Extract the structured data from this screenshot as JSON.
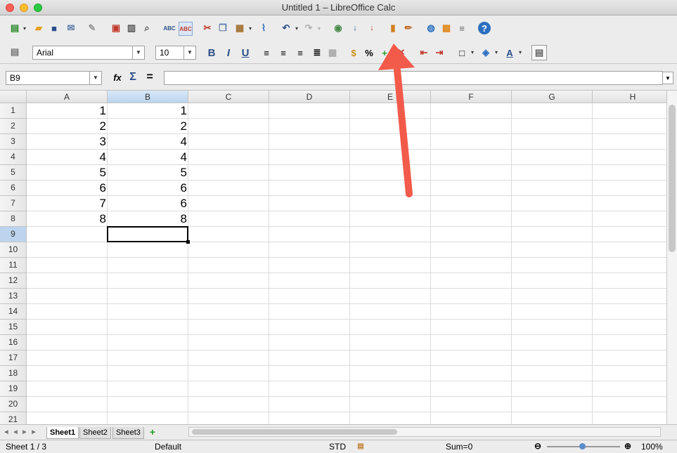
{
  "window": {
    "title": "Untitled 1 – LibreOffice Calc"
  },
  "toolbar": {
    "font_name": "Arial",
    "font_size": "10",
    "bold": "B",
    "italic": "I",
    "underline": "U",
    "percent": "%",
    "spell_label": "ABC",
    "autospell_label": "ABC"
  },
  "formula_bar": {
    "name_box": "B9",
    "function_wizard": "fx",
    "sum": "Σ",
    "equals": "=",
    "formula": ""
  },
  "columns": [
    "A",
    "B",
    "C",
    "D",
    "E",
    "F",
    "G",
    "H"
  ],
  "selected_column": "B",
  "rows": [
    "1",
    "2",
    "3",
    "4",
    "5",
    "6",
    "7",
    "8",
    "9",
    "10",
    "11",
    "12",
    "13",
    "14",
    "15",
    "16",
    "17",
    "18",
    "19",
    "20",
    "21"
  ],
  "selected_row": "9",
  "data": {
    "A": [
      "1",
      "2",
      "3",
      "4",
      "5",
      "6",
      "7",
      "8"
    ],
    "B": [
      "1",
      "2",
      "4",
      "4",
      "5",
      "6",
      "6",
      "8"
    ]
  },
  "sheets": [
    "Sheet1",
    "Sheet2",
    "Sheet3"
  ],
  "active_sheet": "Sheet1",
  "status": {
    "sheet": "Sheet 1 / 3",
    "style": "Default",
    "mode": "STD",
    "sum": "Sum=0",
    "zoom": "100%"
  },
  "annotation": {
    "arrow_color": "#f25a4a"
  }
}
